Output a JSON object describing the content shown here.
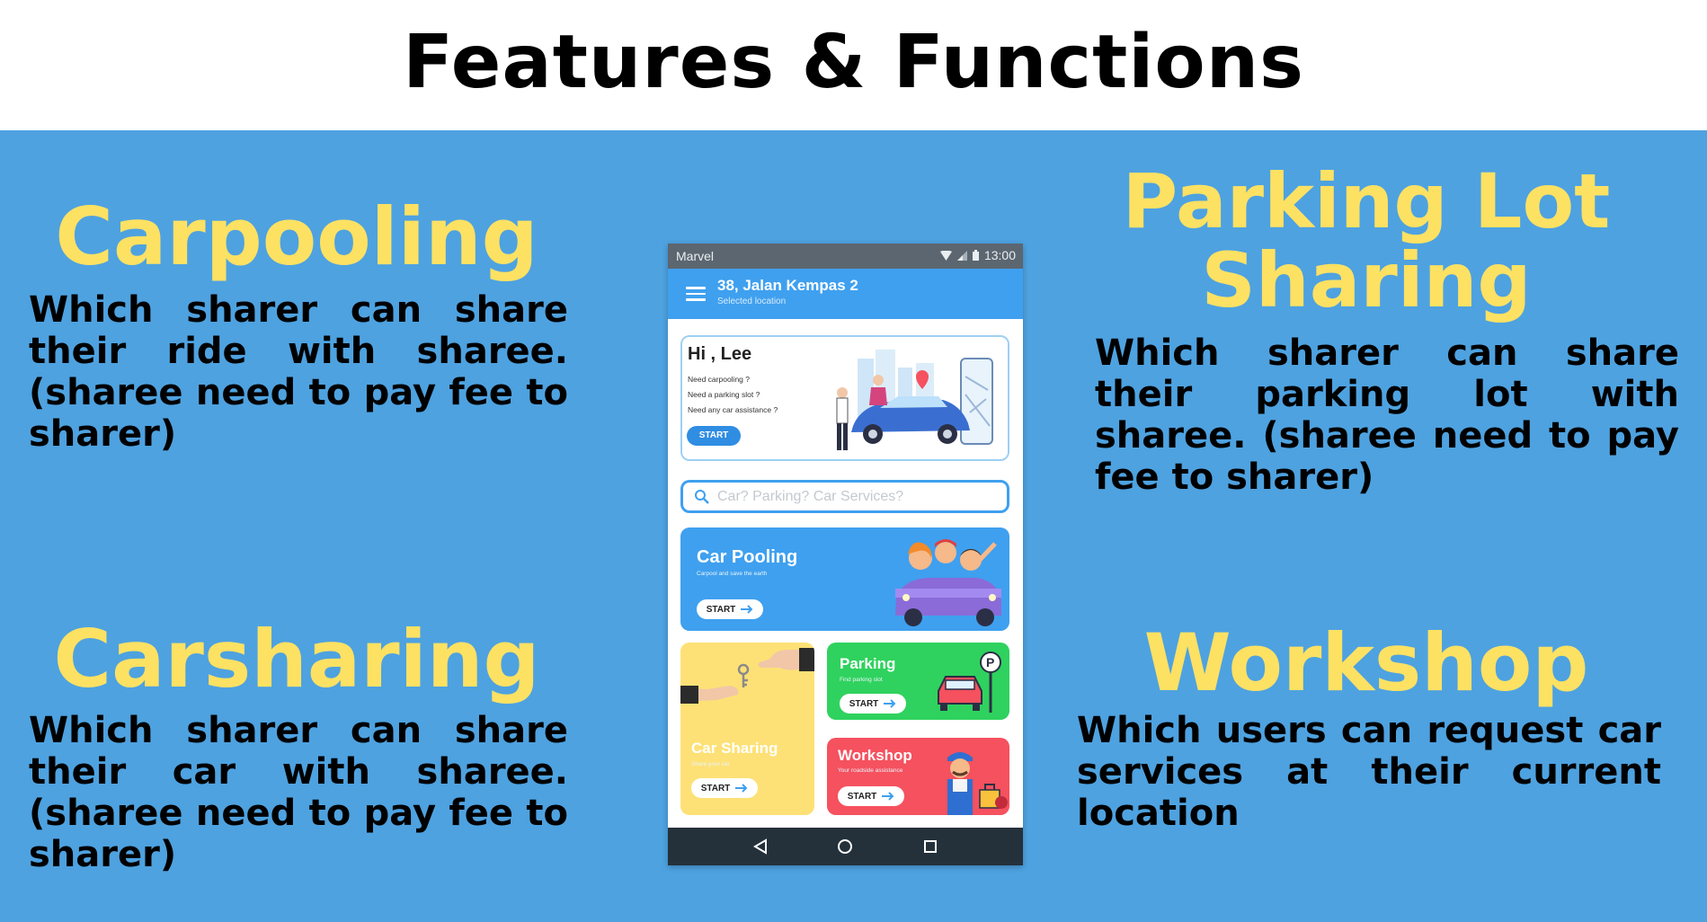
{
  "slide": {
    "title": "Features & Functions"
  },
  "features": {
    "carpooling": {
      "title": "Carpooling",
      "description": "Which sharer can share their ride with sharee. (sharee need to pay fee to sharer)"
    },
    "carsharing": {
      "title": "Carsharing",
      "description": "Which sharer can share their car with sharee. (sharee need to pay fee to sharer)"
    },
    "parking": {
      "title": "Parking Lot Sharing",
      "description": "Which sharer can share their parking lot with sharee. (sharee need to pay fee to sharer)"
    },
    "workshop": {
      "title": "Workshop",
      "description": "Which users can request car services at their current location"
    }
  },
  "phone": {
    "status_bar": {
      "carrier": "Marvel",
      "time": "13:00",
      "icons": [
        "wifi-icon",
        "signal-icon",
        "battery-icon"
      ]
    },
    "app_bar": {
      "location": "38, Jalan Kempas 2",
      "location_sub": "Selected location"
    },
    "greeting": {
      "hi": "Hi , Lee",
      "lines": [
        "Need carpooling ?",
        "Need a parking slot ?",
        "Need any car assistance ?"
      ],
      "start_label": "START"
    },
    "search": {
      "placeholder": "Car? Parking? Car Services?"
    },
    "tiles": {
      "carpool": {
        "title": "Car Pooling",
        "subtitle": "Carpool and save the earth",
        "start_label": "START"
      },
      "carsharing": {
        "title": "Car Sharing",
        "subtitle": "Share your car",
        "start_label": "START"
      },
      "parking": {
        "title": "Parking",
        "subtitle": "Find parking slot",
        "start_label": "START"
      },
      "workshop": {
        "title": "Workshop",
        "subtitle": "Your roadside assistance",
        "start_label": "START"
      }
    },
    "nav": [
      "back-icon",
      "home-icon",
      "recents-icon"
    ]
  },
  "colors": {
    "panel_blue": "#4ea2e0",
    "title_yellow": "#fde163",
    "app_blue": "#3fa0ef",
    "carsharing_yellow": "#fde176",
    "parking_green": "#2fd25e",
    "workshop_red": "#f5515f"
  }
}
